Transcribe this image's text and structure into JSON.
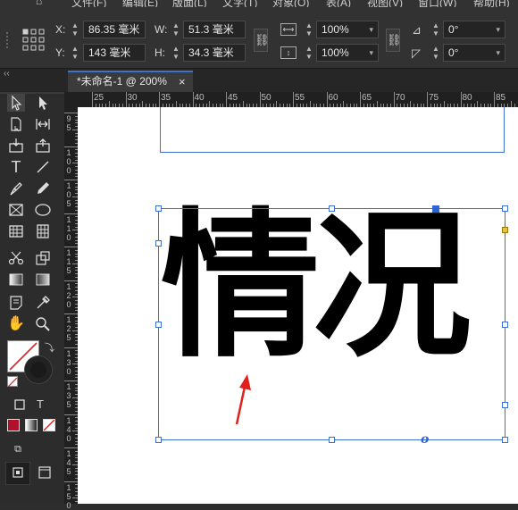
{
  "menu": {
    "items": [
      "文件(F)",
      "编辑(E)",
      "版面(L)",
      "文字(T)",
      "对象(O)",
      "表(A)",
      "视图(V)",
      "窗口(W)",
      "帮助(H)"
    ]
  },
  "control": {
    "x_label": "X:",
    "x_value": "86.35 毫米",
    "y_label": "Y:",
    "y_value": "143 毫米",
    "w_label": "W:",
    "w_value": "51.3 毫米",
    "h_label": "H:",
    "h_value": "34.3 毫米",
    "scale_x": "100%",
    "scale_y": "100%",
    "rotate": "0°",
    "shear": "0°"
  },
  "tab": {
    "title": "*未命名-1 @ 200%",
    "close": "×"
  },
  "ruler": {
    "h_labels": [
      "25",
      "30",
      "35",
      "40",
      "45",
      "50",
      "55",
      "60",
      "65",
      "70",
      "75",
      "80",
      "85"
    ],
    "v_labels": [
      "95",
      "100",
      "105",
      "110",
      "115",
      "120",
      "125",
      "130",
      "135",
      "140",
      "145",
      "150"
    ]
  },
  "canvas": {
    "text": "情况",
    "arrow_color": "#e0201a",
    "frame_color": "#3d6fd6",
    "overflow_mark": "o"
  },
  "toolbox": {
    "type_label": "T"
  },
  "colors": {
    "accent_red": "#b0102c",
    "highlight_yellow": "#e8c03a"
  }
}
